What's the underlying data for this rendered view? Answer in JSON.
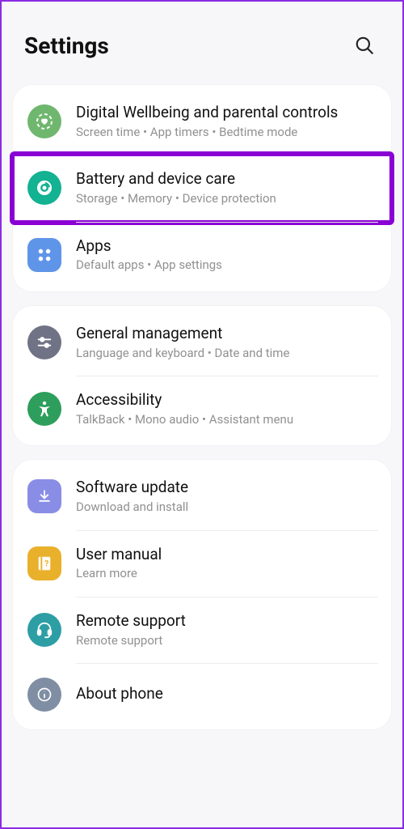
{
  "header": {
    "title": "Settings"
  },
  "groups": [
    {
      "items": [
        {
          "id": "wellbeing",
          "title": "Digital Wellbeing and parental controls",
          "subtitle": "Screen time  •  App timers  •  Bedtime mode",
          "icon_color": "#6fb76e",
          "highlighted": false
        },
        {
          "id": "devicecare",
          "title": "Battery and device care",
          "subtitle": "Storage  •  Memory  •  Device protection",
          "icon_color": "#12b292",
          "highlighted": true
        },
        {
          "id": "apps",
          "title": "Apps",
          "subtitle": "Default apps  •  App settings",
          "icon_color": "#5f95e8",
          "highlighted": false
        }
      ]
    },
    {
      "items": [
        {
          "id": "general",
          "title": "General management",
          "subtitle": "Language and keyboard  •  Date and time",
          "icon_color": "#6f7385",
          "highlighted": false
        },
        {
          "id": "accessibility",
          "title": "Accessibility",
          "subtitle": "TalkBack  •  Mono audio  •  Assistant menu",
          "icon_color": "#2e9e5c",
          "highlighted": false
        }
      ]
    },
    {
      "items": [
        {
          "id": "softwareupdate",
          "title": "Software update",
          "subtitle": "Download and install",
          "icon_color": "#8a8de6",
          "highlighted": false
        },
        {
          "id": "usermanual",
          "title": "User manual",
          "subtitle": "Learn more",
          "icon_color": "#e9b02c",
          "highlighted": false
        },
        {
          "id": "remotesupport",
          "title": "Remote support",
          "subtitle": "Remote support",
          "icon_color": "#2e9ea5",
          "highlighted": false
        },
        {
          "id": "aboutphone",
          "title": "About phone",
          "subtitle": "",
          "icon_color": "#7f8ea3",
          "highlighted": false
        }
      ]
    }
  ]
}
